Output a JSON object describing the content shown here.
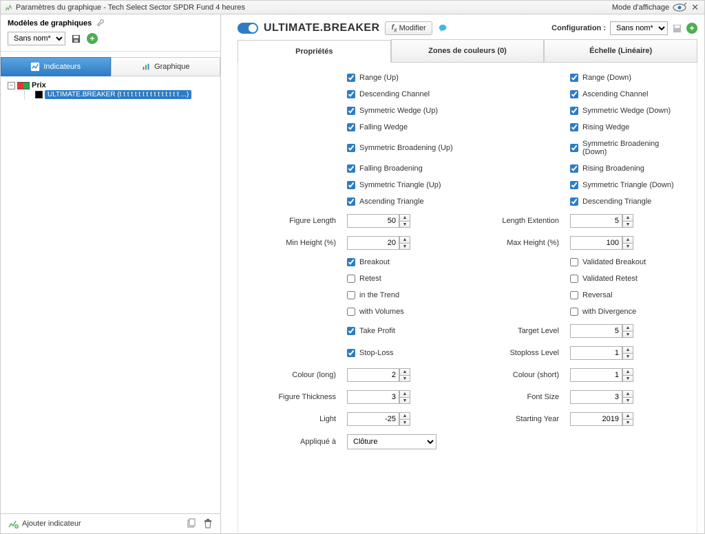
{
  "titlebar": {
    "title": "Paramètres du graphique - Tech Select Sector SPDR Fund 4 heures",
    "display_mode": "Mode d'affichage"
  },
  "sidebar": {
    "models_title": "Modèles de graphiques",
    "name_select": "Sans nom*",
    "tab_indicators": "Indicateurs",
    "tab_chart": "Graphique",
    "tree_root": "Prix",
    "tree_child": "ULTIMATE.BREAKER (t t t t t t t t t t t t t t t t ...)",
    "add_indicator": "Ajouter indicateur"
  },
  "content": {
    "title": "ULTIMATE.BREAKER",
    "modify_btn": "Modifier",
    "config_label": "Configuration :",
    "config_value": "Sans nom*",
    "tabs": {
      "props": "Propriétés",
      "zones": "Zones de couleurs (0)",
      "scale": "Échelle (Linéaire)"
    }
  },
  "checks": {
    "range_up": "Range (Up)",
    "range_down": "Range (Down)",
    "desc_channel": "Descending Channel",
    "asc_channel": "Ascending Channel",
    "sym_wedge_up": "Symmetric Wedge (Up)",
    "sym_wedge_down": "Symmetric Wedge (Down)",
    "fall_wedge": "Falling Wedge",
    "rise_wedge": "Rising Wedge",
    "sym_broad_up": "Symmetric Broadening (Up)",
    "sym_broad_down": "Symmetric Broadening (Down)",
    "fall_broad": "Falling Broadening",
    "rise_broad": "Rising Broadening",
    "sym_tri_up": "Symmetric Triangle (Up)",
    "sym_tri_down": "Symmetric Triangle (Down)",
    "asc_tri": "Ascending Triangle",
    "desc_tri": "Descending Triangle",
    "breakout": "Breakout",
    "val_breakout": "Validated Breakout",
    "retest": "Retest",
    "val_retest": "Validated Retest",
    "in_trend": "in the Trend",
    "reversal": "Reversal",
    "with_vol": "with Volumes",
    "with_div": "with Divergence",
    "take_profit": "Take Profit",
    "stop_loss": "Stop-Loss"
  },
  "labels": {
    "figure_length": "Figure Length",
    "length_ext": "Length Extention",
    "min_height": "Min Height (%)",
    "max_height": "Max Height (%)",
    "target_level": "Target Level",
    "stoploss_level": "Stoploss Level",
    "colour_long": "Colour (long)",
    "colour_short": "Colour (short)",
    "figure_thickness": "Figure Thickness",
    "font_size": "Font Size",
    "light": "Light",
    "starting_year": "Starting Year",
    "applied_to": "Appliqué à"
  },
  "values": {
    "figure_length": "50",
    "length_ext": "5",
    "min_height": "20",
    "max_height": "100",
    "target_level": "5",
    "stoploss_level": "1",
    "colour_long": "2",
    "colour_short": "1",
    "figure_thickness": "3",
    "font_size": "3",
    "light": "-25",
    "starting_year": "2019",
    "applied_to": "Clôture"
  }
}
